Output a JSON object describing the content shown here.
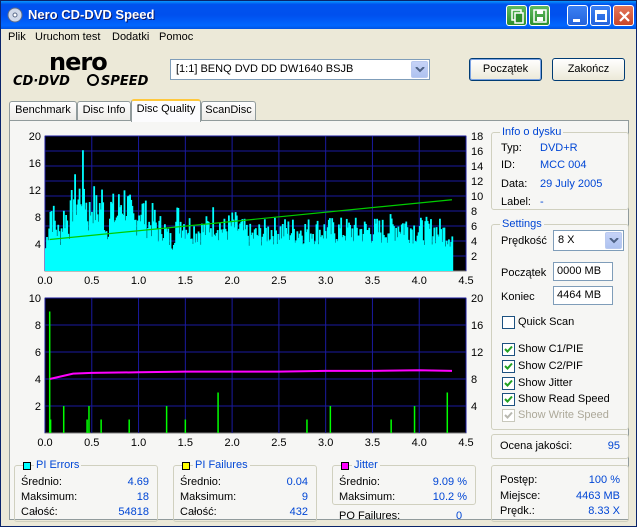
{
  "window": {
    "title": "Nero CD-DVD Speed"
  },
  "menu": [
    "Plik",
    "Uruchom test",
    "Dodatki",
    "Pomoc"
  ],
  "drive": {
    "selected": "[1:1]  BENQ DVD DD DW1640 BSJB"
  },
  "buttons": {
    "start": "Początek",
    "end": "Zakończ"
  },
  "tabs": [
    "Benchmark",
    "Disc Info",
    "Disc Quality",
    "ScanDisc"
  ],
  "active_tab": "Disc Quality",
  "disc_info": {
    "title": "Info o dysku",
    "type_label": "Typ:",
    "type": "DVD+R",
    "id_label": "ID:",
    "id": "MCC 004",
    "date_label": "Data:",
    "date": "29 July 2005",
    "label_label": "Label:",
    "label": "-"
  },
  "settings": {
    "title": "Settings",
    "speed_label": "Prędkość",
    "speed": "8 X",
    "start_label": "Początek",
    "start": "0000 MB",
    "end_label": "Koniec",
    "end": "4464 MB",
    "options": [
      {
        "label": "Quick Scan",
        "checked": false,
        "enabled": true
      },
      {
        "label": "Show C1/PIE",
        "checked": true,
        "enabled": true
      },
      {
        "label": "Show C2/PIF",
        "checked": true,
        "enabled": true
      },
      {
        "label": "Show Jitter",
        "checked": true,
        "enabled": true
      },
      {
        "label": "Show Read Speed",
        "checked": true,
        "enabled": true
      },
      {
        "label": "Show Write Speed",
        "checked": true,
        "enabled": false
      }
    ]
  },
  "quality": {
    "label": "Ocena jakości:",
    "value": "95"
  },
  "progress": {
    "progress_label": "Postęp:",
    "progress": "100 %",
    "position_label": "Miejsce:",
    "position": "4463 MB",
    "speed_label": "Prędk.:",
    "speed": "8.33 X"
  },
  "stats": {
    "pi_errors": {
      "title": "PI Errors",
      "color": "#00ffff",
      "avg_label": "Średnio:",
      "avg": "4.69",
      "max_label": "Maksimum:",
      "max": "18",
      "total_label": "Całość:",
      "total": "54818"
    },
    "pi_failures": {
      "title": "PI Failures",
      "color": "#ffff00",
      "avg_label": "Średnio:",
      "avg": "0.04",
      "max_label": "Maksimum:",
      "max": "9",
      "total_label": "Całość:",
      "total": "432"
    },
    "jitter": {
      "title": "Jitter",
      "color": "#ff00ff",
      "avg_label": "Średnio:",
      "avg": "9.09 %",
      "max_label": "Maksimum:",
      "max": "10.2 %",
      "po_label": "PO Failures:",
      "po": "0"
    }
  },
  "colors": {
    "plot_bg": "#000000",
    "grid": "#1a1aa0",
    "pie": "#00ffff",
    "pif": "#00ff00",
    "jitter": "#ff00ff",
    "speed": "#00cc00"
  },
  "chart_data": [
    {
      "type": "area",
      "x_ticks": [
        "0.0",
        "0.5",
        "1.0",
        "1.5",
        "2.0",
        "2.5",
        "3.0",
        "3.5",
        "4.0",
        "4.5"
      ],
      "xlim": [
        0,
        4.5
      ],
      "y_left_ticks": [
        "4",
        "8",
        "12",
        "16",
        "20"
      ],
      "ylim_left": [
        0,
        20
      ],
      "y_right_ticks": [
        "2",
        "4",
        "6",
        "8",
        "10",
        "12",
        "14",
        "16",
        "18"
      ],
      "ylim_right": [
        0,
        18
      ],
      "series": [
        {
          "values_x": [
            0.0,
            0.05,
            0.1,
            0.15,
            0.2,
            0.25,
            0.3,
            0.35,
            0.4,
            0.45,
            0.5,
            0.55,
            0.6,
            0.65,
            0.7,
            0.75,
            0.8,
            0.85,
            0.9,
            0.95,
            1.0,
            1.05,
            1.1,
            1.15,
            1.2,
            1.25,
            1.3,
            1.35,
            1.4,
            1.5,
            1.6,
            1.7,
            1.8,
            1.9,
            2.0,
            2.2,
            2.4,
            2.6,
            2.8,
            3.0,
            3.2,
            3.4,
            3.6,
            3.8,
            4.0,
            4.2,
            4.35
          ],
          "values": [
            4,
            11,
            8,
            6,
            10,
            8,
            13,
            12,
            16,
            9,
            12,
            10,
            12,
            7,
            11,
            9,
            12,
            12,
            10,
            8,
            11,
            10,
            8,
            9,
            7,
            8,
            6,
            5,
            9,
            8,
            7,
            7,
            9,
            7,
            8,
            6,
            7,
            7,
            7,
            7,
            7,
            7,
            7,
            8,
            7,
            7,
            6
          ]
        },
        {
          "values_x": [
            0.05,
            4.35
          ],
          "values": [
            4.2,
            9.5
          ]
        }
      ]
    },
    {
      "type": "line",
      "x_ticks": [
        "0.0",
        "0.5",
        "1.0",
        "1.5",
        "2.0",
        "2.5",
        "3.0",
        "3.5",
        "4.0",
        "4.5"
      ],
      "xlim": [
        0,
        4.5
      ],
      "y_left_ticks": [
        "2",
        "4",
        "6",
        "8",
        "10"
      ],
      "ylim_left": [
        0,
        10
      ],
      "y_right_ticks": [
        "4",
        "8",
        "12",
        "16",
        "20"
      ],
      "ylim_right": [
        0,
        20
      ],
      "series": [
        {
          "values_x": [
            0.05,
            0.06,
            0.2,
            0.45,
            0.47,
            0.6,
            0.9,
            1.3,
            1.5,
            1.85,
            2.8,
            3.05,
            3.7,
            3.95,
            4.3
          ],
          "values": [
            9,
            1,
            2,
            1,
            2,
            1,
            1,
            2,
            1,
            3,
            1,
            2,
            1,
            2,
            3
          ]
        },
        {
          "values_x": [
            0.05,
            0.3,
            0.5,
            1.0,
            1.5,
            2.0,
            2.5,
            3.0,
            3.5,
            4.0,
            4.35
          ],
          "values": [
            8.0,
            8.8,
            8.9,
            9.0,
            9.1,
            9.1,
            9.1,
            9.2,
            9.2,
            9.3,
            9.2
          ]
        }
      ]
    }
  ]
}
